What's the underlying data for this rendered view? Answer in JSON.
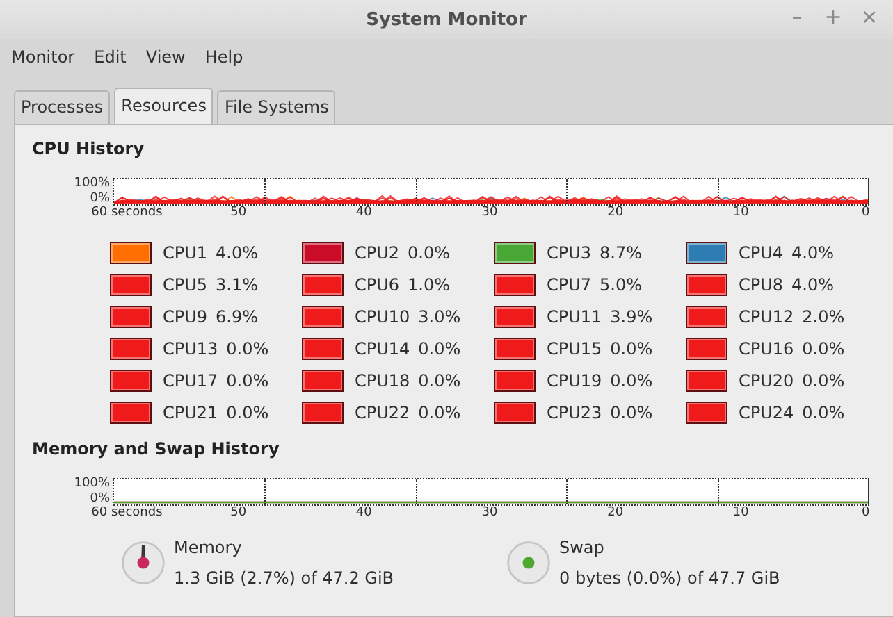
{
  "window": {
    "title": "System Monitor",
    "controls": [
      "–",
      "+",
      "×"
    ]
  },
  "menu": [
    "Monitor",
    "Edit",
    "View",
    "Help"
  ],
  "tabs": [
    {
      "label": "Processes",
      "selected": false
    },
    {
      "label": "Resources",
      "selected": true
    },
    {
      "label": "File Systems",
      "selected": false
    }
  ],
  "cpu_history": {
    "title": "CPU History",
    "y_labels": [
      "100%",
      "0%"
    ],
    "x_labels": [
      "60 seconds",
      "50",
      "40",
      "30",
      "20",
      "10",
      "0"
    ],
    "cpus": [
      {
        "name": "CPU1",
        "value": "4.0%",
        "color": "#ff6e00"
      },
      {
        "name": "CPU2",
        "value": "0.0%",
        "color": "#cb0c29"
      },
      {
        "name": "CPU3",
        "value": "8.7%",
        "color": "#49a835"
      },
      {
        "name": "CPU4",
        "value": "4.0%",
        "color": "#2d7db3"
      },
      {
        "name": "CPU5",
        "value": "3.1%",
        "color": "#ef1a1a"
      },
      {
        "name": "CPU6",
        "value": "1.0%",
        "color": "#ef1a1a"
      },
      {
        "name": "CPU7",
        "value": "5.0%",
        "color": "#ef1a1a"
      },
      {
        "name": "CPU8",
        "value": "4.0%",
        "color": "#ef1a1a"
      },
      {
        "name": "CPU9",
        "value": "6.9%",
        "color": "#ef1a1a"
      },
      {
        "name": "CPU10",
        "value": "3.0%",
        "color": "#ef1a1a"
      },
      {
        "name": "CPU11",
        "value": "3.9%",
        "color": "#ef1a1a"
      },
      {
        "name": "CPU12",
        "value": "2.0%",
        "color": "#ef1a1a"
      },
      {
        "name": "CPU13",
        "value": "0.0%",
        "color": "#ef1a1a"
      },
      {
        "name": "CPU14",
        "value": "0.0%",
        "color": "#ef1a1a"
      },
      {
        "name": "CPU15",
        "value": "0.0%",
        "color": "#ef1a1a"
      },
      {
        "name": "CPU16",
        "value": "0.0%",
        "color": "#ef1a1a"
      },
      {
        "name": "CPU17",
        "value": "0.0%",
        "color": "#ef1a1a"
      },
      {
        "name": "CPU18",
        "value": "0.0%",
        "color": "#ef1a1a"
      },
      {
        "name": "CPU19",
        "value": "0.0%",
        "color": "#ef1a1a"
      },
      {
        "name": "CPU20",
        "value": "0.0%",
        "color": "#ef1a1a"
      },
      {
        "name": "CPU21",
        "value": "0.0%",
        "color": "#ef1a1a"
      },
      {
        "name": "CPU22",
        "value": "0.0%",
        "color": "#ef1a1a"
      },
      {
        "name": "CPU23",
        "value": "0.0%",
        "color": "#ef1a1a"
      },
      {
        "name": "CPU24",
        "value": "0.0%",
        "color": "#ef1a1a"
      }
    ]
  },
  "memory_history": {
    "title": "Memory and Swap History",
    "y_labels": [
      "100%",
      "0%"
    ],
    "x_labels": [
      "60 seconds",
      "50",
      "40",
      "30",
      "20",
      "10",
      "0"
    ],
    "items": [
      {
        "name": "Memory",
        "usage": "1.3 GiB (2.7%) of 47.2 GiB",
        "kind": "needle",
        "color": "#c8285f"
      },
      {
        "name": "Swap",
        "usage": "0 bytes (0.0%) of 47.7 GiB",
        "kind": "dot",
        "color": "#4ea72e"
      }
    ]
  }
}
